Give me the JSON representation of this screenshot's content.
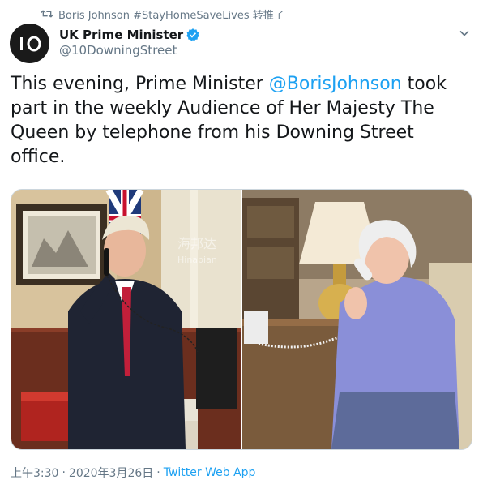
{
  "retweet": {
    "icon": "retweet-icon",
    "text": "Boris Johnson #StayHomeSaveLives 转推了"
  },
  "author": {
    "avatar_text": "IO",
    "display_name": "UK Prime Minister",
    "verified_icon": "verified-badge-icon",
    "handle": "@10DowningStreet"
  },
  "tweet": {
    "text_before": "This evening, Prime Minister ",
    "mention": "@BorisJohnson",
    "text_after": " took part in the weekly Audience of Her Majesty The Queen by telephone from his Downing Street office."
  },
  "media": {
    "left_image_label": "Prime Minister on the telephone in Downing Street office",
    "right_image_label": "Her Majesty The Queen on the telephone",
    "watermark_cn": "海邦达",
    "watermark_en": "Hinabian"
  },
  "meta": {
    "time": "上午3:30",
    "date": "2020年3月26日",
    "separator": "·",
    "source": "Twitter Web App"
  },
  "colors": {
    "accent": "#1da1f2",
    "secondary_text": "#657786"
  }
}
